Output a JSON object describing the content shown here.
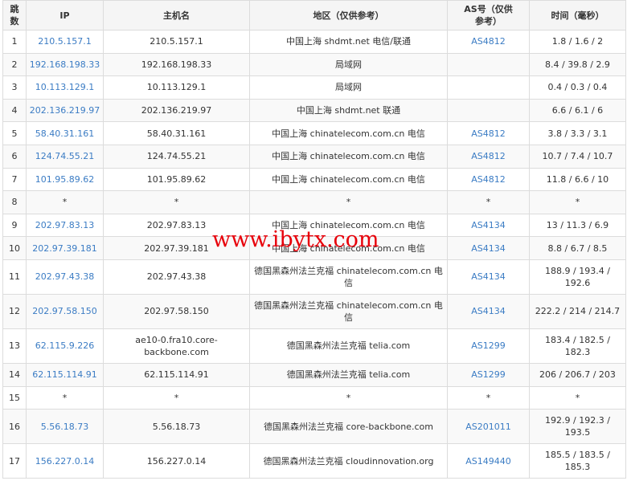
{
  "headers": [
    "跳数",
    "IP",
    "主机名",
    "地区（仅供参考）",
    "AS号（仅供参考）",
    "时间（毫秒）"
  ],
  "rows": [
    {
      "hop": "1",
      "ip": "210.5.157.1",
      "host": "210.5.157.1",
      "region": "中国上海 shdmt.net 电信/联通",
      "as": "AS4812",
      "time": "1.8 / 1.6 / 2"
    },
    {
      "hop": "2",
      "ip": "192.168.198.33",
      "host": "192.168.198.33",
      "region": "局域网",
      "as": "",
      "time": "8.4 / 39.8 / 2.9"
    },
    {
      "hop": "3",
      "ip": "10.113.129.1",
      "host": "10.113.129.1",
      "region": "局域网",
      "as": "",
      "time": "0.4 / 0.3 / 0.4"
    },
    {
      "hop": "4",
      "ip": "202.136.219.97",
      "host": "202.136.219.97",
      "region": "中国上海 shdmt.net 联通",
      "as": "",
      "time": "6.6 / 6.1 / 6"
    },
    {
      "hop": "5",
      "ip": "58.40.31.161",
      "host": "58.40.31.161",
      "region": "中国上海 chinatelecom.com.cn 电信",
      "as": "AS4812",
      "time": "3.8 / 3.3 / 3.1"
    },
    {
      "hop": "6",
      "ip": "124.74.55.21",
      "host": "124.74.55.21",
      "region": "中国上海 chinatelecom.com.cn 电信",
      "as": "AS4812",
      "time": "10.7 / 7.4 / 10.7"
    },
    {
      "hop": "7",
      "ip": "101.95.89.62",
      "host": "101.95.89.62",
      "region": "中国上海 chinatelecom.com.cn 电信",
      "as": "AS4812",
      "time": "11.8 / 6.6 / 10"
    },
    {
      "hop": "8",
      "ip": "*",
      "host": "*",
      "region": "*",
      "as": "*",
      "time": "*"
    },
    {
      "hop": "9",
      "ip": "202.97.83.13",
      "host": "202.97.83.13",
      "region": "中国上海 chinatelecom.com.cn 电信",
      "as": "AS4134",
      "time": "13 / 11.3 / 6.9"
    },
    {
      "hop": "10",
      "ip": "202.97.39.181",
      "host": "202.97.39.181",
      "region": "中国上海 chinatelecom.com.cn 电信",
      "as": "AS4134",
      "time": "8.8 / 6.7 / 8.5"
    },
    {
      "hop": "11",
      "ip": "202.97.43.38",
      "host": "202.97.43.38",
      "region": "德国黑森州法兰克福 chinatelecom.com.cn 电信",
      "as": "AS4134",
      "time": "188.9 / 193.4 / 192.6"
    },
    {
      "hop": "12",
      "ip": "202.97.58.150",
      "host": "202.97.58.150",
      "region": "德国黑森州法兰克福 chinatelecom.com.cn 电信",
      "as": "AS4134",
      "time": "222.2 / 214 / 214.7"
    },
    {
      "hop": "13",
      "ip": "62.115.9.226",
      "host": "ae10-0.fra10.core-backbone.com",
      "region": "德国黑森州法兰克福 telia.com",
      "as": "AS1299",
      "time": "183.4 / 182.5 / 182.3"
    },
    {
      "hop": "14",
      "ip": "62.115.114.91",
      "host": "62.115.114.91",
      "region": "德国黑森州法兰克福 telia.com",
      "as": "AS1299",
      "time": "206 / 206.7 / 203"
    },
    {
      "hop": "15",
      "ip": "*",
      "host": "*",
      "region": "*",
      "as": "*",
      "time": "*"
    },
    {
      "hop": "16",
      "ip": "5.56.18.73",
      "host": "5.56.18.73",
      "region": "德国黑森州法兰克福 core-backbone.com",
      "as": "AS201011",
      "time": "192.9 / 192.3 / 193.5"
    },
    {
      "hop": "17",
      "ip": "156.227.0.14",
      "host": "156.227.0.14",
      "region": "德国黑森州法兰克福 cloudinnovation.org",
      "as": "AS149440",
      "time": "185.5 / 183.5 / 185.3"
    }
  ],
  "tall_rows": [
    "11",
    "12",
    "13",
    "16",
    "17"
  ],
  "watermark": "www.ibytx.com",
  "colors": {
    "link": "#3b7cc4",
    "watermark": "#e8000a",
    "header_bg": "#f5f5f5",
    "border": "#dcdcdc"
  }
}
